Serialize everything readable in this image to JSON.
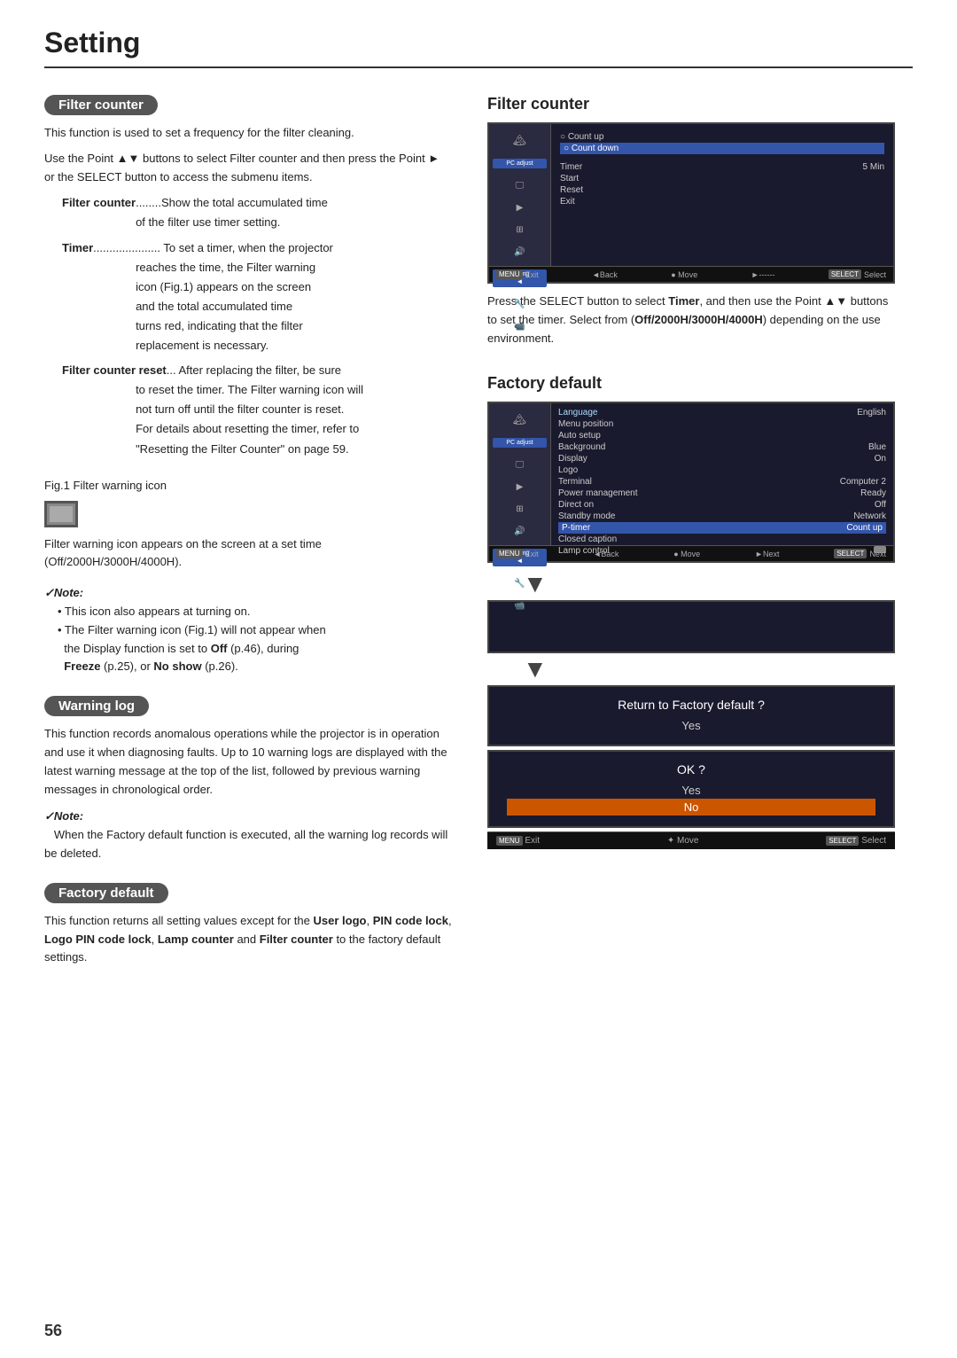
{
  "page": {
    "title": "Setting",
    "page_number": "56"
  },
  "filter_counter_section": {
    "header": "Filter counter",
    "intro1": "This function is used to set a frequency for the filter cleaning.",
    "intro2": "Use the Point ▲▼ buttons to select Filter counter and then press the Point ► or the SELECT button to access the submenu items.",
    "items": [
      {
        "term": "Filter counter",
        "dots": "........",
        "desc": "Show the total accumulated time of the filter use timer setting."
      },
      {
        "term": "Timer",
        "dots": "...................",
        "desc": "To set a timer, when the projector reaches the time, the Filter warning icon (Fig.1) appears on the screen and the total accumulated time turns red, indicating that the filter replacement is necessary."
      },
      {
        "term": "Filter counter reset",
        "dots": "...",
        "desc": "After replacing the filter, be sure to reset the timer. The Filter warning icon will not turn off until the filter counter is reset. For details about resetting the timer, refer to \"Resetting the Filter Counter\" on page 59."
      }
    ],
    "fig1_label": "Fig.1    Filter warning icon",
    "fig1_note": "Filter warning icon appears on the screen at a set time (Off/2000H/3000H/4000H).",
    "note_label": "✓Note:",
    "notes": [
      "This icon also appears at turning on.",
      "The Filter warning icon (Fig.1) will not appear when the Display function is set to Off (p.46), during Freeze (p.25), or No show (p.26)."
    ]
  },
  "warning_log_section": {
    "header": "Warning log",
    "body1": "This function records anomalous operations while the projector is in operation and use it when diagnosing faults. Up to 10 warning logs are displayed with the latest warning message at the top of the list, followed by previous warning messages in chronological order.",
    "note_label": "✓Note:",
    "note_text": "When the Factory default function is executed, all the warning log records will be deleted."
  },
  "factory_default_section": {
    "header": "Factory default",
    "body": "This function returns all setting values except for the User logo, PIN code lock, Logo PIN code lock, Lamp counter and Filter counter to the factory default settings."
  },
  "right_filter_counter": {
    "title": "Filter counter",
    "screen": {
      "sidebar_items": [
        "",
        "PC adjust",
        "",
        "",
        "",
        "",
        "Setting",
        "",
        ""
      ],
      "menu_items": [
        {
          "label": "Count up",
          "value": "",
          "highlighted": false
        },
        {
          "label": "Count down",
          "value": "",
          "highlighted": true
        },
        {
          "label": "",
          "value": "",
          "highlighted": false
        },
        {
          "label": "Timer",
          "value": "5 Min",
          "highlighted": false
        },
        {
          "label": "Start",
          "value": "",
          "highlighted": false
        },
        {
          "label": "Reset",
          "value": "",
          "highlighted": false
        },
        {
          "label": "Exit",
          "value": "",
          "highlighted": false
        }
      ],
      "footer": [
        "MENU Exit",
        "◄Back",
        "● Move",
        "►------",
        "SELECT Select"
      ]
    },
    "desc1": "Press the SELECT button to select Timer, and then use the Point ▲▼ buttons to set the timer. Select from (Off/2000H/3000H/4000H) depending on the use environment."
  },
  "right_factory_default": {
    "title": "Factory default",
    "screen": {
      "menu_items": [
        {
          "label": "Language",
          "value": "English"
        },
        {
          "label": "Menu position",
          "value": ""
        },
        {
          "label": "Auto setup",
          "value": ""
        },
        {
          "label": "Background",
          "value": "Blue"
        },
        {
          "label": "Display",
          "value": "On"
        },
        {
          "label": "Logo",
          "value": ""
        },
        {
          "label": "Terminal",
          "value": "Computer 2"
        },
        {
          "label": "Power management",
          "value": "Ready"
        },
        {
          "label": "Direct on",
          "value": "Off"
        },
        {
          "label": "Standby mode",
          "value": "Network"
        },
        {
          "label": "P-timer",
          "value": "Count up"
        },
        {
          "label": "Closed caption",
          "value": ""
        },
        {
          "label": "Lamp control",
          "value": ""
        }
      ],
      "footer": [
        "MENU Exit",
        "◄Back",
        "● Move",
        "►Next",
        "SELECT Next"
      ]
    },
    "dialog1": {
      "text": "Return to Factory default ?",
      "option": "Yes"
    },
    "dialog2": {
      "text": "OK ?",
      "option_yes": "Yes",
      "option_no": "No"
    },
    "final_footer": [
      "MENU Exit",
      "✦ Move",
      "SELECT Select"
    ]
  }
}
